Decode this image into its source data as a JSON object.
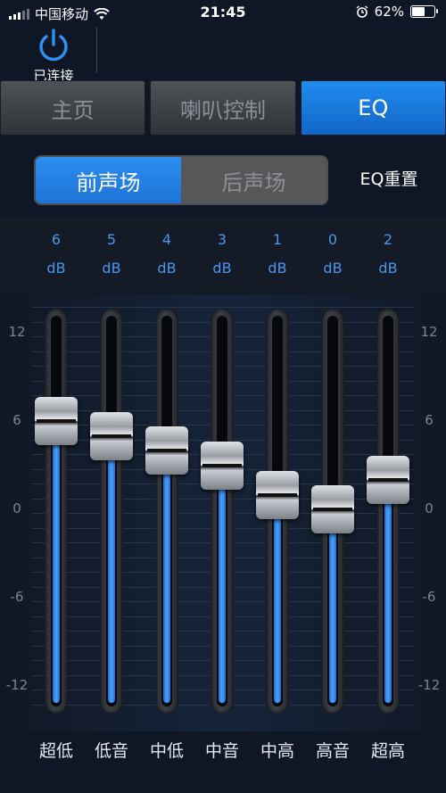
{
  "status": {
    "carrier": "中国移动",
    "time": "21:45",
    "battery": "62%",
    "battery_level": 0.62
  },
  "connection": {
    "label": "已连接"
  },
  "tabs": [
    {
      "label": "主页",
      "active": false
    },
    {
      "label": "喇叭控制",
      "active": false
    },
    {
      "label": "EQ",
      "active": true
    }
  ],
  "sound_field": {
    "options": [
      {
        "label": "前声场",
        "active": true
      },
      {
        "label": "后声场",
        "active": false
      }
    ],
    "reset_label": "EQ重置"
  },
  "axis": {
    "labels": [
      "12",
      "6",
      "0",
      "-6",
      "-12"
    ]
  },
  "unit": "dB",
  "bands": [
    {
      "name": "超低",
      "value": "6"
    },
    {
      "name": "低音",
      "value": "5"
    },
    {
      "name": "中低",
      "value": "4"
    },
    {
      "name": "中音",
      "value": "3"
    },
    {
      "name": "中高",
      "value": "1"
    },
    {
      "name": "高音",
      "value": "0"
    },
    {
      "name": "超高",
      "value": "2"
    }
  ],
  "colors": {
    "accent": "#1f8cf0",
    "value_text": "#4a97ee",
    "background": "#0f1625"
  }
}
